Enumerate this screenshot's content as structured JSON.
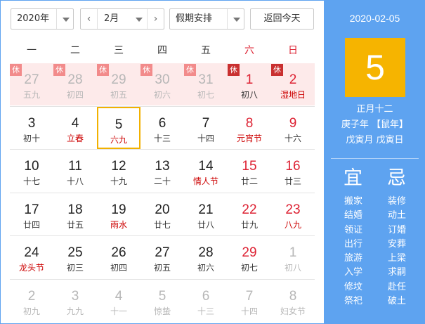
{
  "toolbar": {
    "year": "2020年",
    "month": "2月",
    "prev_symbol": "‹",
    "next_symbol": "›",
    "holiday": "假期安排",
    "today": "返回今天"
  },
  "weekdays": [
    "一",
    "二",
    "三",
    "四",
    "五",
    "六",
    "日"
  ],
  "weeks": [
    [
      {
        "day": "27",
        "lunar": "五九",
        "other": true,
        "rest": true
      },
      {
        "day": "28",
        "lunar": "初四",
        "other": true,
        "rest": true
      },
      {
        "day": "29",
        "lunar": "初五",
        "other": true,
        "rest": true
      },
      {
        "day": "30",
        "lunar": "初六",
        "other": true,
        "rest": true
      },
      {
        "day": "31",
        "lunar": "初七",
        "other": true,
        "rest": true
      },
      {
        "day": "1",
        "lunar": "初八",
        "weekend": true,
        "rest": true,
        "dark": true
      },
      {
        "day": "2",
        "lunar": "湿地日",
        "weekend": true,
        "festival": true,
        "rest": true,
        "dark": true
      }
    ],
    [
      {
        "day": "3",
        "lunar": "初十"
      },
      {
        "day": "4",
        "lunar": "立春",
        "festival": true
      },
      {
        "day": "5",
        "lunar": "六九",
        "festival": true,
        "selected": true
      },
      {
        "day": "6",
        "lunar": "十三"
      },
      {
        "day": "7",
        "lunar": "十四"
      },
      {
        "day": "8",
        "lunar": "元宵节",
        "weekend": true,
        "festival": true
      },
      {
        "day": "9",
        "lunar": "十六",
        "weekend": true
      }
    ],
    [
      {
        "day": "10",
        "lunar": "十七"
      },
      {
        "day": "11",
        "lunar": "十八"
      },
      {
        "day": "12",
        "lunar": "十九"
      },
      {
        "day": "13",
        "lunar": "二十"
      },
      {
        "day": "14",
        "lunar": "情人节",
        "festival": true
      },
      {
        "day": "15",
        "lunar": "廿二",
        "weekend": true
      },
      {
        "day": "16",
        "lunar": "廿三",
        "weekend": true
      }
    ],
    [
      {
        "day": "17",
        "lunar": "廿四"
      },
      {
        "day": "18",
        "lunar": "廿五"
      },
      {
        "day": "19",
        "lunar": "雨水",
        "festival": true
      },
      {
        "day": "20",
        "lunar": "廿七"
      },
      {
        "day": "21",
        "lunar": "廿八"
      },
      {
        "day": "22",
        "lunar": "廿九",
        "weekend": true
      },
      {
        "day": "23",
        "lunar": "八九",
        "weekend": true,
        "festival": true
      }
    ],
    [
      {
        "day": "24",
        "lunar": "龙头节",
        "festival": true
      },
      {
        "day": "25",
        "lunar": "初三"
      },
      {
        "day": "26",
        "lunar": "初四"
      },
      {
        "day": "27",
        "lunar": "初五"
      },
      {
        "day": "28",
        "lunar": "初六"
      },
      {
        "day": "29",
        "lunar": "初七",
        "weekend": true
      },
      {
        "day": "1",
        "lunar": "初八",
        "other": true
      }
    ],
    [
      {
        "day": "2",
        "lunar": "初九",
        "other": true
      },
      {
        "day": "3",
        "lunar": "九九",
        "other": true
      },
      {
        "day": "4",
        "lunar": "十一",
        "other": true
      },
      {
        "day": "5",
        "lunar": "惊蛰",
        "other": true
      },
      {
        "day": "6",
        "lunar": "十三",
        "other": true
      },
      {
        "day": "7",
        "lunar": "十四",
        "other": true
      },
      {
        "day": "8",
        "lunar": "妇女节",
        "other": true
      }
    ]
  ],
  "rest_tag": "休",
  "panel": {
    "date": "2020-02-05",
    "big_day": "5",
    "lunar_date": "正月十二",
    "ganzhi_year": "庚子年 【鼠年】",
    "ganzhi_month_day": "戊寅月 戊寅日",
    "yi_title": "宜",
    "ji_title": "忌",
    "yi": [
      "搬家",
      "结婚",
      "领证",
      "出行",
      "旅游",
      "入学",
      "修坟",
      "祭祀"
    ],
    "ji": [
      "装修",
      "动土",
      "订婚",
      "安葬",
      "上梁",
      "求嗣",
      "赴任",
      "破土"
    ]
  },
  "colors": {
    "accent": "#5ea3f0",
    "highlight": "#f6b400",
    "festival": "#cc0000",
    "rest_bg": "#fdeaea",
    "rest_tag": "#f28b8b",
    "rest_tag_dark": "#c93030"
  }
}
